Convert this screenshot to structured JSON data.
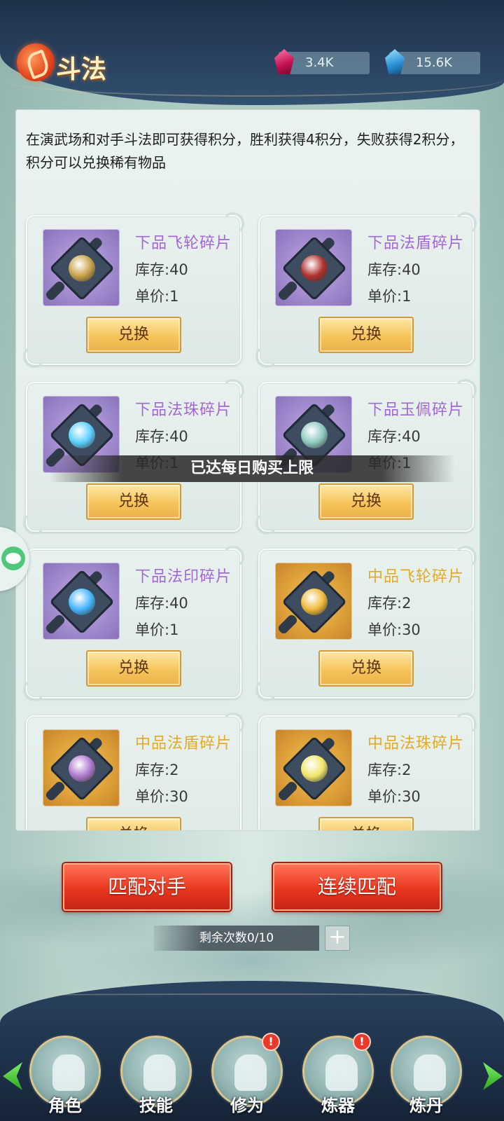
{
  "header": {
    "title": "斗法",
    "currencies": [
      {
        "icon": "red-gem-icon",
        "value": "3.4K"
      },
      {
        "icon": "blue-crystal-icon",
        "value": "15.6K"
      }
    ]
  },
  "panel": {
    "description": "在演武场和对手斗法即可获得积分，胜利获得4积分，失败获得2积分，积分可以兑换稀有物品",
    "items": [
      {
        "name": "下品飞轮碎片",
        "tier": "purple",
        "stock": "库存:40",
        "price": "单价:1",
        "button": "兑换",
        "icon": "flying-wheel-fragment-icon"
      },
      {
        "name": "下品法盾碎片",
        "tier": "purple",
        "stock": "库存:40",
        "price": "单价:1",
        "button": "兑换",
        "icon": "magic-shield-fragment-icon"
      },
      {
        "name": "下品法珠碎片",
        "tier": "purple",
        "stock": "库存:40",
        "price": "单价:1",
        "button": "兑换",
        "icon": "magic-orb-fragment-icon"
      },
      {
        "name": "下品玉佩碎片",
        "tier": "purple",
        "stock": "库存:40",
        "price": "单价:1",
        "button": "兑换",
        "icon": "jade-pendant-fragment-icon"
      },
      {
        "name": "下品法印碎片",
        "tier": "purple",
        "stock": "库存:40",
        "price": "单价:1",
        "button": "兑换",
        "icon": "magic-seal-fragment-icon"
      },
      {
        "name": "中品飞轮碎片",
        "tier": "gold",
        "stock": "库存:2",
        "price": "单价:30",
        "button": "兑换",
        "icon": "flying-wheel-fragment-icon"
      },
      {
        "name": "中品法盾碎片",
        "tier": "gold",
        "stock": "库存:2",
        "price": "单价:30",
        "button": "兑换",
        "icon": "magic-shield-fragment-icon"
      },
      {
        "name": "中品法珠碎片",
        "tier": "gold",
        "stock": "库存:2",
        "price": "单价:30",
        "button": "兑换",
        "icon": "magic-orb-fragment-icon"
      }
    ]
  },
  "toast": "已达每日购买上限",
  "actions": {
    "match_opponent": "匹配对手",
    "continuous_match": "连续匹配",
    "remaining": "剩余次数0/10",
    "plus": "+"
  },
  "nav": {
    "items": [
      {
        "label": "角色",
        "icon": "character-icon",
        "badge": ""
      },
      {
        "label": "技能",
        "icon": "skill-flame-icon",
        "badge": ""
      },
      {
        "label": "修为",
        "icon": "yin-yang-icon",
        "badge": "!"
      },
      {
        "label": "炼器",
        "icon": "sword-forge-icon",
        "badge": "!"
      },
      {
        "label": "炼丹",
        "icon": "alchemy-cauldron-icon",
        "badge": ""
      }
    ]
  },
  "colors": {
    "tier_purple": "#a467d6",
    "tier_gold": "#e4aa26",
    "accent_red": "#e8371f",
    "button_gold": "#f6c45a",
    "header_navy": "#1e3149"
  }
}
